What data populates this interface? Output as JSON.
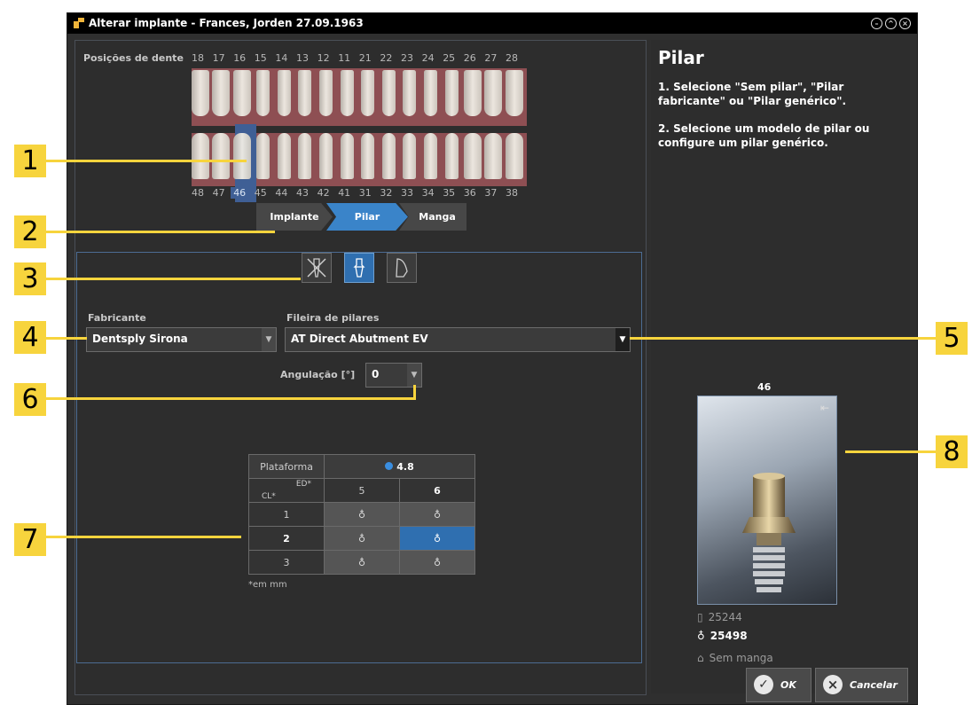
{
  "window": {
    "title": "Alterar implante - Frances, Jorden 27.09.1963"
  },
  "teeth": {
    "label": "Posições de dente",
    "upper": [
      "18",
      "17",
      "16",
      "15",
      "14",
      "13",
      "12",
      "11",
      "21",
      "22",
      "23",
      "24",
      "25",
      "26",
      "27",
      "28"
    ],
    "lower": [
      "48",
      "47",
      "46",
      "45",
      "44",
      "43",
      "42",
      "41",
      "31",
      "32",
      "33",
      "34",
      "35",
      "36",
      "37",
      "38"
    ],
    "selected": "46"
  },
  "steps": [
    {
      "label": "Implante",
      "active": false
    },
    {
      "label": "Pilar",
      "active": true
    },
    {
      "label": "Manga",
      "active": false
    }
  ],
  "manufacturer": {
    "label": "Fabricante",
    "value": "Dentsply Sirona"
  },
  "abutment_line": {
    "label": "Fileira de pilares",
    "value": "AT Direct Abutment EV"
  },
  "angulation": {
    "label": "Angulação [°]",
    "value": "0"
  },
  "abutment_table": {
    "platform_label": "Plataforma",
    "platform_value": "4.8",
    "ed_label": "ED*",
    "cl_label": "CL*",
    "columns": [
      "5",
      "6"
    ],
    "rows": [
      "1",
      "2",
      "3"
    ],
    "selected_row": "2",
    "selected_col": "6",
    "footnote": "*em mm"
  },
  "right_panel": {
    "heading": "Pilar",
    "instructions": [
      "1. Selecione \"Sem pilar\", \"Pilar fabricante\" ou \"Pilar genérico\".",
      "2. Selecione um modelo de pilar ou configure um pilar genérico."
    ],
    "preview_label": "46",
    "implant_id": "25244",
    "abutment_id": "25498",
    "sleeve": "Sem manga"
  },
  "buttons": {
    "ok": "OK",
    "cancel": "Cancelar"
  },
  "callouts": [
    "1",
    "2",
    "3",
    "4",
    "5",
    "6",
    "7",
    "8"
  ],
  "colors": {
    "callout": "#f7d43d",
    "accent": "#2f6fb0",
    "gum": "#a0565a"
  }
}
